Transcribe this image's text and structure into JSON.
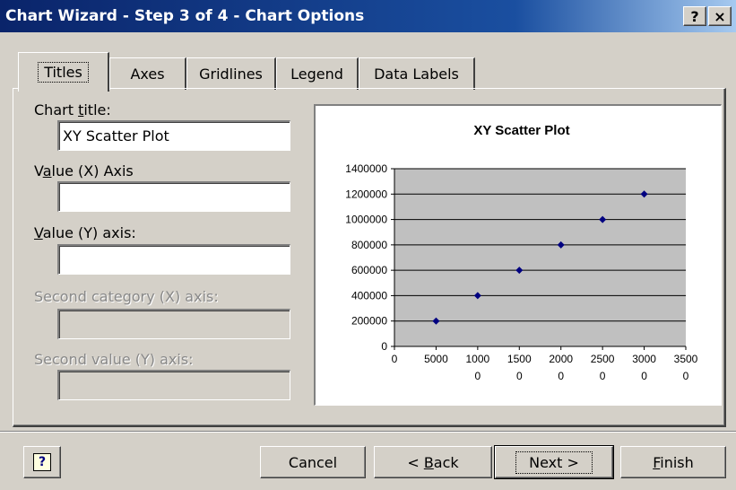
{
  "window": {
    "title": "Chart Wizard - Step 3 of 4 - Chart Options",
    "help_button": "?",
    "close_button": "×"
  },
  "tabs": [
    {
      "label": "Titles",
      "active": true
    },
    {
      "label": "Axes",
      "active": false
    },
    {
      "label": "Gridlines",
      "active": false
    },
    {
      "label": "Legend",
      "active": false
    },
    {
      "label": "Data Labels",
      "active": false
    }
  ],
  "form": {
    "chart_title": {
      "label_pre": "Chart ",
      "label_key": "t",
      "label_post": "itle:",
      "value": "XY Scatter Plot"
    },
    "x_axis": {
      "label_pre": "V",
      "label_key": "a",
      "label_post": "lue (X) Axis",
      "value": ""
    },
    "y_axis": {
      "label_pre": "",
      "label_key": "V",
      "label_post": "alue (Y) axis:",
      "value": ""
    },
    "second_x": {
      "label": "Second category (X) axis:",
      "value": ""
    },
    "second_y": {
      "label": "Second value (Y) axis:",
      "value": ""
    }
  },
  "chart_data": {
    "type": "scatter",
    "title": "XY Scatter Plot",
    "xlabel": "",
    "ylabel": "",
    "x": [
      5000,
      10000,
      15000,
      20000,
      25000,
      30000
    ],
    "y": [
      200000,
      400000,
      600000,
      800000,
      1000000,
      1200000
    ],
    "xlim": [
      0,
      35000
    ],
    "ylim": [
      0,
      1400000
    ],
    "x_ticks": [
      0,
      5000,
      10000,
      15000,
      20000,
      25000,
      30000,
      35000
    ],
    "x_tick_labels": [
      [
        "0",
        ""
      ],
      [
        "5000",
        ""
      ],
      [
        "1000",
        "0"
      ],
      [
        "1500",
        "0"
      ],
      [
        "2000",
        "0"
      ],
      [
        "2500",
        "0"
      ],
      [
        "3000",
        "0"
      ],
      [
        "3500",
        "0"
      ]
    ],
    "y_ticks": [
      0,
      200000,
      400000,
      600000,
      800000,
      1000000,
      1200000,
      1400000
    ],
    "y_tick_labels": [
      "0",
      "200000",
      "400000",
      "600000",
      "800000",
      "1000000",
      "1200000",
      "1400000"
    ],
    "grid": "horizontal",
    "plot_area_color": "#c0c0c0",
    "marker_color": "#000080"
  },
  "buttons": {
    "help": "?",
    "cancel": "Cancel",
    "back_pre": "< ",
    "back_key": "B",
    "back_post": "ack",
    "next": "Next >",
    "finish_key": "F",
    "finish_post": "inish"
  },
  "colors": {
    "title_bar_start": "#0a246a",
    "title_bar_end": "#a6caf0",
    "dialog_face": "#d4d0c8"
  }
}
